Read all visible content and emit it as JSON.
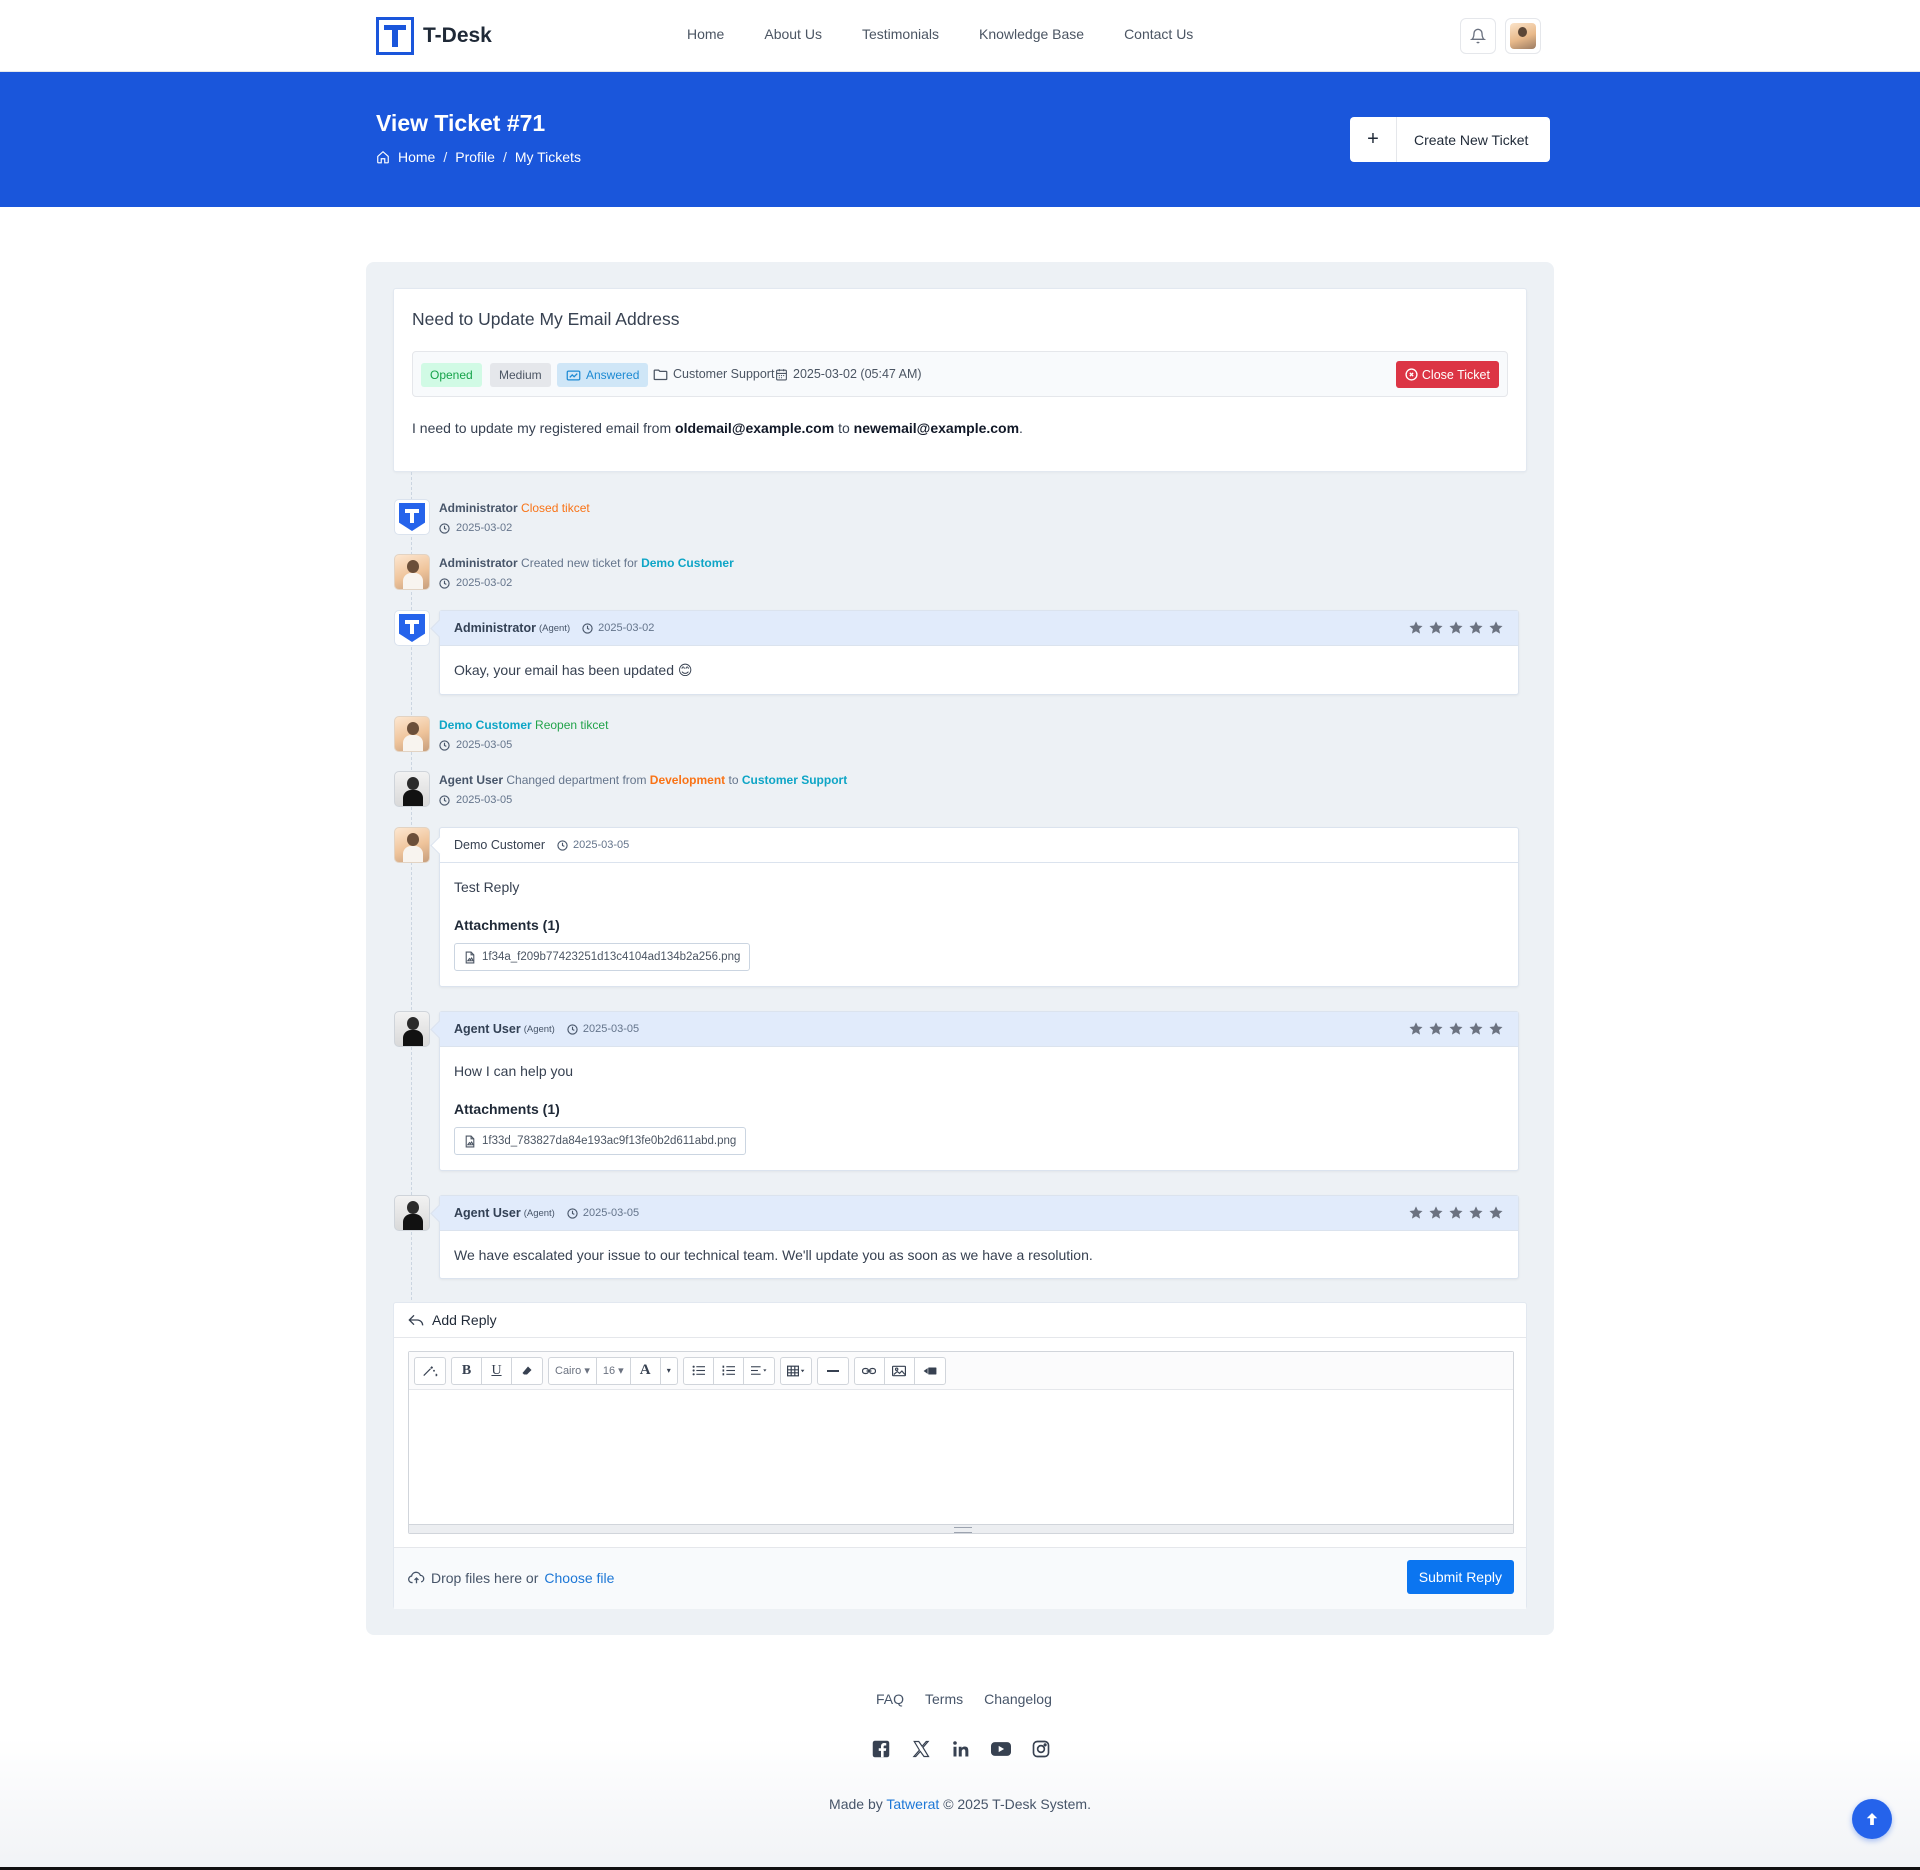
{
  "brand": {
    "name": "T-Desk"
  },
  "nav": {
    "items": [
      "Home",
      "About Us",
      "Testimonials",
      "Knowledge Base",
      "Contact Us"
    ]
  },
  "hero": {
    "title": "View Ticket #71",
    "breadcrumb": [
      "Home",
      "Profile",
      "My Tickets"
    ],
    "create_button": "Create New Ticket"
  },
  "ticket": {
    "subject": "Need to Update My Email Address",
    "status": "Opened",
    "priority": "Medium",
    "reply_status": "Answered",
    "department": "Customer Support",
    "date": "2025-03-02 (05:47 AM)",
    "close_button": "Close Ticket",
    "body_prefix": "I need to update my registered email from",
    "old_email": "oldemail@example.com",
    "body_mid": "to",
    "new_email": "newemail@example.com",
    "body_suffix": "."
  },
  "activities": [
    {
      "actor": "Administrator",
      "action": "Closed tikcet",
      "date": "2025-03-02"
    },
    {
      "actor": "Administrator",
      "action": "Created new ticket for",
      "target": "Demo Customer",
      "date": "2025-03-02"
    },
    {
      "actor": "Demo Customer",
      "action": "Reopen tikcet",
      "date": "2025-03-05"
    },
    {
      "actor": "Agent User",
      "action": "Changed department from",
      "from": "Development",
      "mid": "to",
      "to": "Customer Support",
      "date": "2025-03-05"
    }
  ],
  "replies": [
    {
      "author": "Administrator",
      "role": "(Agent)",
      "date": "2025-03-02",
      "text": "Okay, your email has been updated 😊",
      "rating": 0
    },
    {
      "author": "Demo Customer",
      "date": "2025-03-05",
      "text": "Test Reply",
      "attachments_title": "Attachments (1)",
      "attachment": "1f34a_f209b77423251d13c4104ad134b2a256.png"
    },
    {
      "author": "Agent User",
      "role": "(Agent)",
      "date": "2025-03-05",
      "text": "How I can help you",
      "attachments_title": "Attachments (1)",
      "attachment": "1f33d_783827da84e193ac9f13fe0b2d611abd.png",
      "rating": 0
    },
    {
      "author": "Agent User",
      "role": "(Agent)",
      "date": "2025-03-05",
      "text": "We have escalated your issue to our technical team. We'll update you as soon as we have a resolution.",
      "rating": 0
    }
  ],
  "add_reply": {
    "title": "Add Reply",
    "font_name": "Cairo",
    "font_size": "16",
    "drop_text": "Drop files here or",
    "choose_file": "Choose file",
    "submit": "Submit Reply"
  },
  "footer": {
    "links": [
      "FAQ",
      "Terms",
      "Changelog"
    ],
    "social": [
      "facebook-icon",
      "x-icon",
      "linkedin-icon",
      "youtube-icon",
      "instagram-icon"
    ],
    "credit_prefix": "Made by",
    "credit_link": "Tatwerat",
    "credit_suffix": "© 2025 T-Desk System."
  },
  "colors": {
    "primary": "#1a56db",
    "danger": "#dc3545",
    "success": "#16a34a",
    "accent_orange": "#f97316",
    "accent_cyan": "#0ea5c6"
  }
}
